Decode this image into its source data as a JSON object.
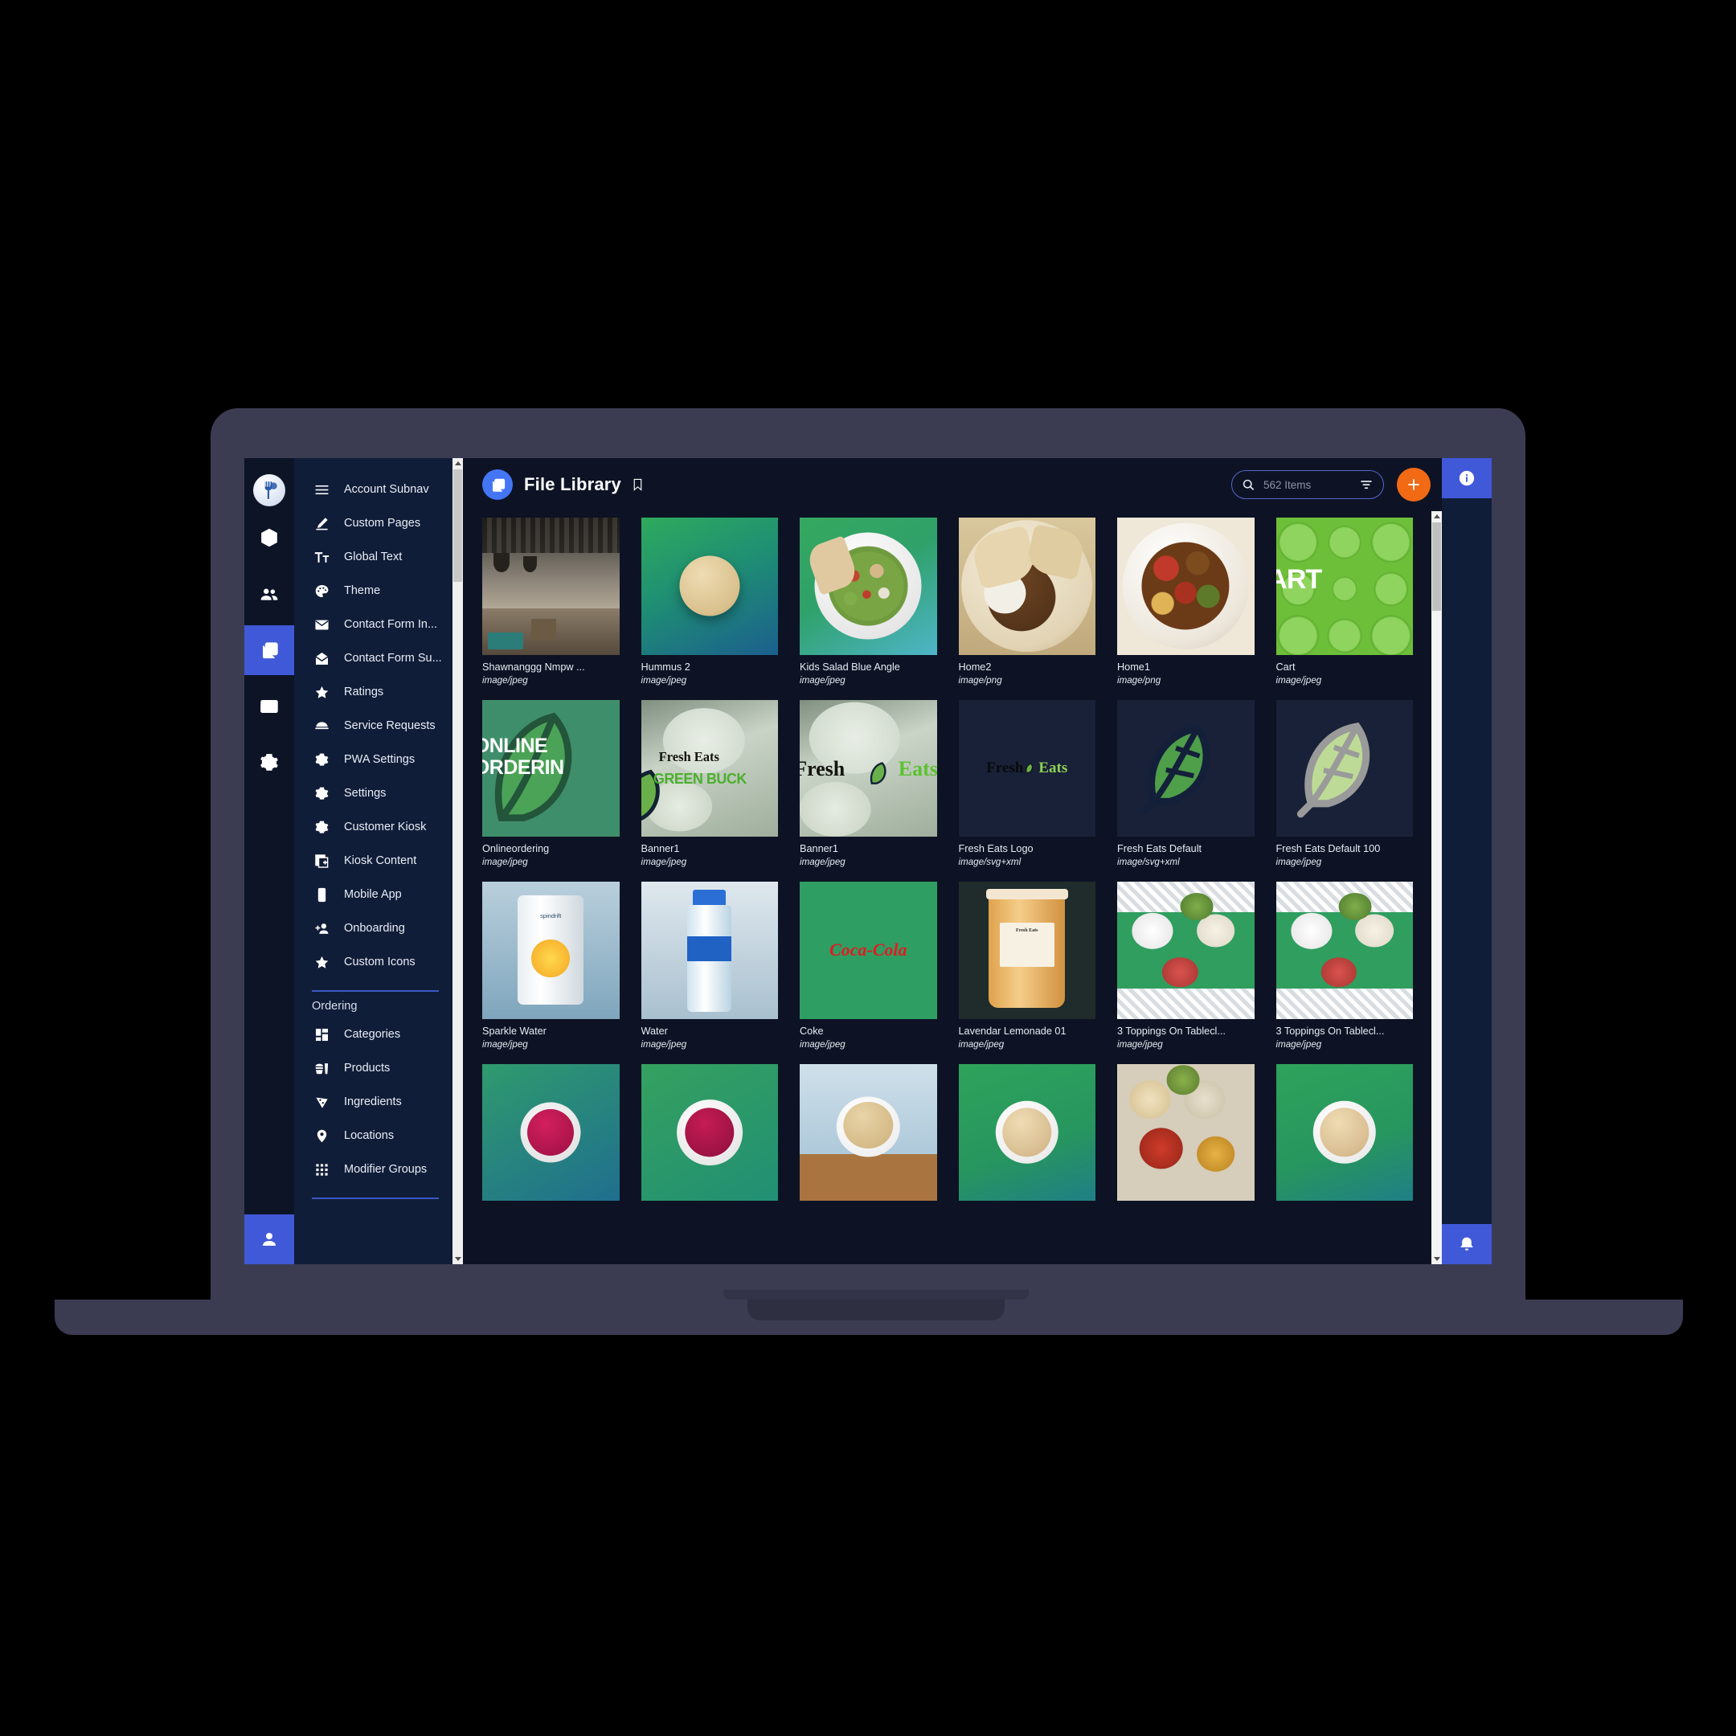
{
  "app": {
    "logo_icon": "fork-circle-logo",
    "rail_icons": [
      {
        "name": "cube-icon"
      },
      {
        "name": "people-icon"
      },
      {
        "name": "media-library-icon",
        "active": true
      },
      {
        "name": "layout-icon"
      },
      {
        "name": "gear-icon"
      }
    ],
    "user_icon": "user-icon"
  },
  "subnav": {
    "items": [
      {
        "label": "Account Subnav",
        "icon": "hamburger-icon"
      },
      {
        "label": "Custom Pages",
        "icon": "pencil-icon"
      },
      {
        "label": "Global Text",
        "icon": "text-format-icon"
      },
      {
        "label": "Theme",
        "icon": "palette-icon"
      },
      {
        "label": "Contact Form In...",
        "icon": "envelope-icon"
      },
      {
        "label": "Contact Form Su...",
        "icon": "inbox-icon"
      },
      {
        "label": "Ratings",
        "icon": "star-icon"
      },
      {
        "label": "Service Requests",
        "icon": "room-service-icon"
      },
      {
        "label": "PWA Settings",
        "icon": "gear-icon"
      },
      {
        "label": "Settings",
        "icon": "gear-icon"
      },
      {
        "label": "Customer Kiosk",
        "icon": "gear-icon"
      },
      {
        "label": "Kiosk Content",
        "icon": "add-page-icon"
      },
      {
        "label": "Mobile App",
        "icon": "mobile-icon"
      },
      {
        "label": "Onboarding",
        "icon": "add-user-icon"
      },
      {
        "label": "Custom Icons",
        "icon": "star-icon"
      }
    ],
    "section_title": "Ordering",
    "ordering_items": [
      {
        "label": "Categories",
        "icon": "grid-blocks-icon"
      },
      {
        "label": "Products",
        "icon": "burger-drink-icon"
      },
      {
        "label": "Ingredients",
        "icon": "pizza-slice-icon"
      },
      {
        "label": "Locations",
        "icon": "map-pin-icon"
      },
      {
        "label": "Modifier Groups",
        "icon": "dots-grid-icon"
      }
    ]
  },
  "header": {
    "badge_icon": "media-library-icon",
    "title": "File Library",
    "bookmark_icon": "bookmark-icon",
    "search": {
      "icon": "search-icon",
      "value": "562 Items",
      "placeholder": "Search",
      "filter_icon": "filter-icon"
    },
    "add_label": "+",
    "add_color": "#f26a14"
  },
  "right_rail": {
    "info_icon": "info-icon",
    "bell_icon": "notification-bell-icon"
  },
  "files": [
    {
      "name": "Shawnanggg Nmpw ...",
      "type": "image/jpeg",
      "art": "restaurant"
    },
    {
      "name": "Hummus 2",
      "type": "image/jpeg",
      "art": "hummus-green"
    },
    {
      "name": "Kids Salad Blue Angle",
      "type": "image/jpeg",
      "art": "salad-bowl"
    },
    {
      "name": "Home2",
      "type": "image/png",
      "art": "pita-plate"
    },
    {
      "name": "Home1",
      "type": "image/png",
      "art": "veggie-bowl"
    },
    {
      "name": "Cart",
      "type": "image/jpeg",
      "art": "cart-green"
    },
    {
      "name": "Onlineordering",
      "type": "image/jpeg",
      "art": "online-ordering"
    },
    {
      "name": "Banner1",
      "type": "image/jpeg",
      "art": "banner-green-buck"
    },
    {
      "name": "Banner1",
      "type": "image/jpeg",
      "art": "banner-fresh-eats"
    },
    {
      "name": "Fresh Eats Logo",
      "type": "image/svg+xml",
      "art": "fresh-eats-logo"
    },
    {
      "name": "Fresh Eats Default",
      "type": "image/svg+xml",
      "art": "leaf-navy"
    },
    {
      "name": "Fresh Eats Default 100",
      "type": "image/jpeg",
      "art": "leaf-white"
    },
    {
      "name": "Sparkle Water",
      "type": "image/jpeg",
      "art": "spindrift-can"
    },
    {
      "name": "Water",
      "type": "image/jpeg",
      "art": "water-bottle"
    },
    {
      "name": "Coke",
      "type": "image/jpeg",
      "art": "coca-cola"
    },
    {
      "name": "Lavendar Lemonade 01",
      "type": "image/jpeg",
      "art": "lemonade-cup"
    },
    {
      "name": "3 Toppings On Tablecl...",
      "type": "image/jpeg",
      "art": "toppings-table"
    },
    {
      "name": "3 Toppings On Tablecl...",
      "type": "image/jpeg",
      "art": "toppings-table"
    },
    {
      "name": "",
      "type": "",
      "art": "berry-bowl-teal"
    },
    {
      "name": "",
      "type": "",
      "art": "berry-bowl-green"
    },
    {
      "name": "",
      "type": "",
      "art": "hummus-board"
    },
    {
      "name": "",
      "type": "",
      "art": "hummus-green2"
    },
    {
      "name": "",
      "type": "",
      "art": "mezze-spread"
    },
    {
      "name": "",
      "type": "",
      "art": "hummus-green3"
    }
  ],
  "labels": {
    "spindrift": "spindrift",
    "coke": "Coca-Cola",
    "online_ordering_line1": "ONLINE",
    "online_ordering_line2": "ORDERIN",
    "banner_fresh": "Fresh Eats",
    "banner_green_buck": "GREEN BUCK",
    "fresh": "Fresh",
    "eats": "Eats",
    "cart_text": "ART",
    "lemonade_brand": "Fresh Eats"
  }
}
